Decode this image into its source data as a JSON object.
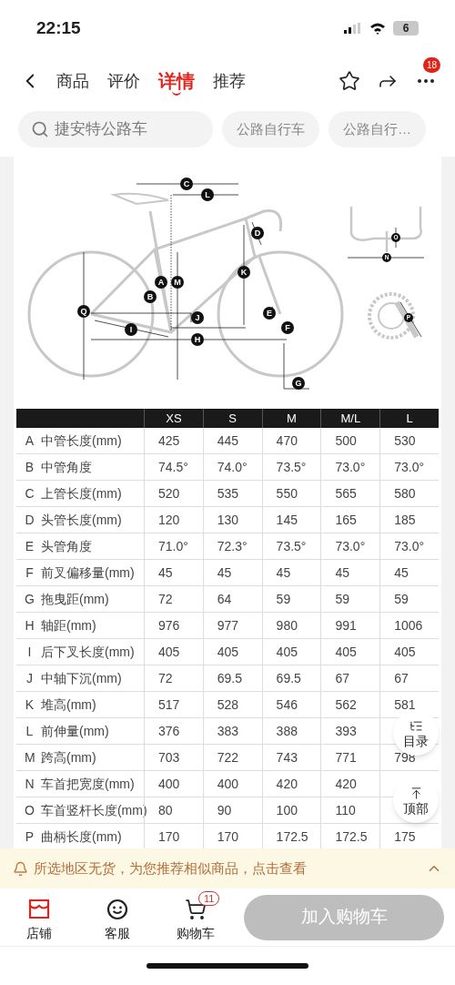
{
  "status_bar": {
    "time": "22:15",
    "battery": "6"
  },
  "nav": {
    "tabs": [
      {
        "label": "商品",
        "selected": false
      },
      {
        "label": "评价",
        "selected": false
      },
      {
        "label": "详情",
        "selected": true
      },
      {
        "label": "推荐",
        "selected": false
      }
    ],
    "more_badge": "18"
  },
  "search": {
    "value": "捷安特公路车",
    "chips": [
      "公路自行车",
      "公路自行…"
    ]
  },
  "diagram": {
    "labels": [
      "C",
      "L",
      "D",
      "K",
      "A",
      "M",
      "B",
      "Q",
      "J",
      "E",
      "F",
      "I",
      "H",
      "G",
      "O",
      "N",
      "P"
    ]
  },
  "table": {
    "columns": [
      "XS",
      "S",
      "M",
      "M/L",
      "L"
    ],
    "rows": [
      {
        "letter": "A",
        "name": "中管长度(mm)",
        "values": [
          "425",
          "445",
          "470",
          "500",
          "530"
        ]
      },
      {
        "letter": "B",
        "name": "中管角度",
        "values": [
          "74.5°",
          "74.0°",
          "73.5°",
          "73.0°",
          "73.0°"
        ]
      },
      {
        "letter": "C",
        "name": "上管长度(mm)",
        "values": [
          "520",
          "535",
          "550",
          "565",
          "580"
        ]
      },
      {
        "letter": "D",
        "name": "头管长度(mm)",
        "values": [
          "120",
          "130",
          "145",
          "165",
          "185"
        ]
      },
      {
        "letter": "E",
        "name": "头管角度",
        "values": [
          "71.0°",
          "72.3°",
          "73.5°",
          "73.0°",
          "73.0°"
        ]
      },
      {
        "letter": "F",
        "name": "前叉偏移量(mm)",
        "values": [
          "45",
          "45",
          "45",
          "45",
          "45"
        ]
      },
      {
        "letter": "G",
        "name": "拖曳距(mm)",
        "values": [
          "72",
          "64",
          "59",
          "59",
          "59"
        ]
      },
      {
        "letter": "H",
        "name": "轴距(mm)",
        "values": [
          "976",
          "977",
          "980",
          "991",
          "1006"
        ]
      },
      {
        "letter": "I",
        "name": "后下叉长度(mm)",
        "values": [
          "405",
          "405",
          "405",
          "405",
          "405"
        ]
      },
      {
        "letter": "J",
        "name": "中轴下沉(mm)",
        "values": [
          "72",
          "69.5",
          "69.5",
          "67",
          "67"
        ]
      },
      {
        "letter": "K",
        "name": "堆高(mm)",
        "values": [
          "517",
          "528",
          "546",
          "562",
          "581"
        ]
      },
      {
        "letter": "L",
        "name": "前伸量(mm)",
        "values": [
          "376",
          "383",
          "388",
          "393"
        ]
      },
      {
        "letter": "M",
        "name": "跨高(mm)",
        "values": [
          "703",
          "722",
          "743",
          "771",
          "798"
        ]
      },
      {
        "letter": "N",
        "name": "车首把宽度(mm)",
        "values": [
          "400",
          "400",
          "420",
          "420"
        ]
      },
      {
        "letter": "O",
        "name": "车首竖杆长度(mm)",
        "values": [
          "80",
          "90",
          "100",
          "110"
        ]
      },
      {
        "letter": "P",
        "name": "曲柄长度(mm)",
        "values": [
          "170",
          "170",
          "172.5",
          "172.5",
          "175"
        ]
      }
    ]
  },
  "floating": [
    {
      "label": "目录"
    },
    {
      "label": "顶部"
    }
  ],
  "notice": {
    "text": "所选地区无货，为您推荐相似商品，点击查看"
  },
  "bottom_bar": {
    "items": [
      {
        "label": "店铺"
      },
      {
        "label": "客服"
      },
      {
        "label": "购物车",
        "badge": "11"
      }
    ],
    "cart_button": {
      "label": "加入购物车",
      "disabled": true
    }
  }
}
